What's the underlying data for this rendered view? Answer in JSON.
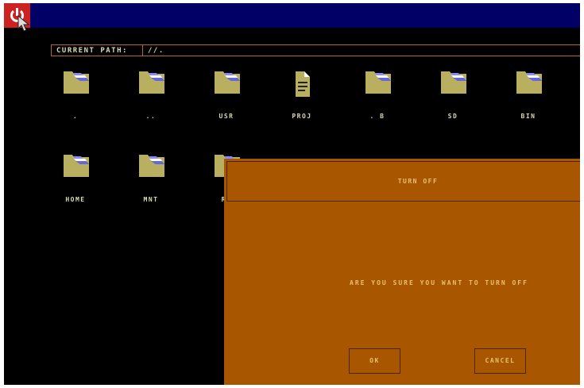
{
  "topbar": {
    "power_icon": "power-icon",
    "cursor_icon": "arrow-cursor-icon"
  },
  "path": {
    "label": "CURRENT PATH:",
    "value": "//."
  },
  "files": [
    {
      "name": ".",
      "type": "folder"
    },
    {
      "name": "..",
      "type": "folder"
    },
    {
      "name": "USR",
      "type": "folder"
    },
    {
      "name": "PROJ",
      "type": "file"
    },
    {
      "name": ". B",
      "type": "folder"
    },
    {
      "name": "SD",
      "type": "folder"
    },
    {
      "name": "BIN",
      "type": "folder"
    },
    {
      "name": "HOME",
      "type": "folder"
    },
    {
      "name": "MNT",
      "type": "folder"
    },
    {
      "name": "RO",
      "type": "folder"
    }
  ],
  "dialog": {
    "title": "TURN OFF",
    "message": "ARE YOU SURE YOU WANT TO TURN OFF",
    "ok_label": "OK",
    "cancel_label": "CANCEL"
  },
  "colors": {
    "background": "#000000",
    "topbar": "#000066",
    "power_button": "#cc2222",
    "folder": "#b8b060",
    "dialog": "#a85600",
    "text": "#d8d8b0",
    "dialog_text": "#e8c070"
  }
}
